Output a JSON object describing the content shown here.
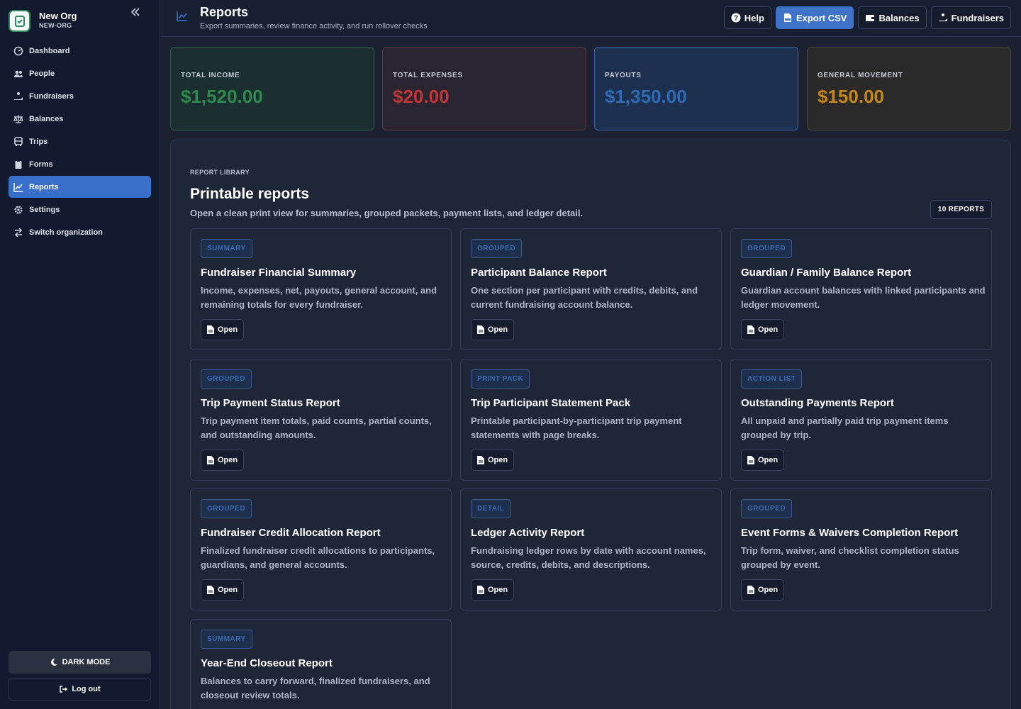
{
  "org": {
    "name": "New Org",
    "code": "NEW-ORG"
  },
  "sidebar": {
    "items": [
      {
        "label": "Dashboard",
        "icon": "dashboard-icon",
        "active": false
      },
      {
        "label": "People",
        "icon": "people-icon",
        "active": false
      },
      {
        "label": "Fundraisers",
        "icon": "fundraisers-icon",
        "active": false
      },
      {
        "label": "Balances",
        "icon": "scale-icon",
        "active": false
      },
      {
        "label": "Trips",
        "icon": "bus-icon",
        "active": false
      },
      {
        "label": "Forms",
        "icon": "clipboard-icon",
        "active": false
      },
      {
        "label": "Reports",
        "icon": "chart-line-icon",
        "active": true
      },
      {
        "label": "Settings",
        "icon": "gear-icon",
        "active": false
      },
      {
        "label": "Switch organization",
        "icon": "switch-icon",
        "active": false
      }
    ],
    "dark_mode_label": "DARK MODE",
    "logout_label": "Log out"
  },
  "header": {
    "title": "Reports",
    "subtitle": "Export summaries, review finance activity, and run rollover checks",
    "buttons": {
      "help": "Help",
      "export": "Export CSV",
      "balances": "Balances",
      "fundraisers": "Fundraisers"
    }
  },
  "stats": [
    {
      "label": "TOTAL INCOME",
      "value": "$1,520.00",
      "color": "#2e8a4e"
    },
    {
      "label": "TOTAL EXPENSES",
      "value": "$20.00",
      "color": "#c43636"
    },
    {
      "label": "PAYOUTS",
      "value": "$1,350.00",
      "color": "#2f6cb5"
    },
    {
      "label": "GENERAL MOVEMENT",
      "value": "$150.00",
      "color": "#c7861b"
    }
  ],
  "library": {
    "eyebrow": "REPORT LIBRARY",
    "title": "Printable reports",
    "description": "Open a clean print view for summaries, grouped packets, payment lists, and ledger detail.",
    "count": "10 REPORTS",
    "open_label": "Open",
    "reports": [
      {
        "badge": "SUMMARY",
        "title": "Fundraiser Financial Summary",
        "description": "Income, expenses, net, payouts, general account, and remaining totals for every fundraiser."
      },
      {
        "badge": "GROUPED",
        "title": "Participant Balance Report",
        "description": "One section per participant with credits, debits, and current fundraising account balance."
      },
      {
        "badge": "GROUPED",
        "title": "Guardian / Family Balance Report",
        "description": "Guardian account balances with linked participants and ledger movement."
      },
      {
        "badge": "GROUPED",
        "title": "Trip Payment Status Report",
        "description": "Trip payment item totals, paid counts, partial counts, and outstanding amounts."
      },
      {
        "badge": "PRINT PACK",
        "title": "Trip Participant Statement Pack",
        "description": "Printable participant-by-participant trip payment statements with page breaks."
      },
      {
        "badge": "ACTION LIST",
        "title": "Outstanding Payments Report",
        "description": "All unpaid and partially paid trip payment items grouped by trip."
      },
      {
        "badge": "GROUPED",
        "title": "Fundraiser Credit Allocation Report",
        "description": "Finalized fundraiser credit allocations to participants, guardians, and general accounts."
      },
      {
        "badge": "DETAIL",
        "title": "Ledger Activity Report",
        "description": "Fundraising ledger rows by date with account names, source, credits, debits, and descriptions."
      },
      {
        "badge": "GROUPED",
        "title": "Event Forms & Waivers Completion Report",
        "description": "Trip form, waiver, and checklist completion status grouped by event."
      },
      {
        "badge": "SUMMARY",
        "title": "Year-End Closeout Report",
        "description": "Balances to carry forward, finalized fundraisers, and closeout review totals."
      }
    ]
  }
}
